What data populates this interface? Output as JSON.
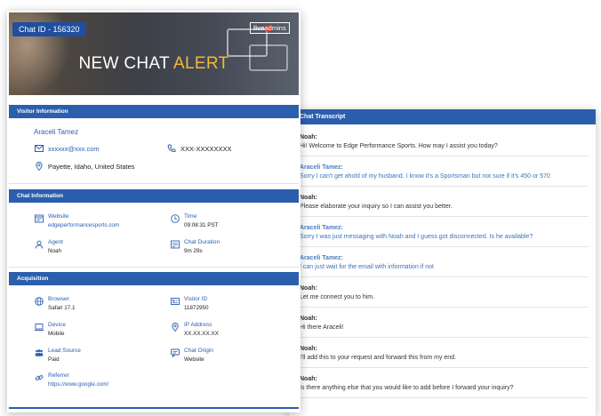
{
  "header": {
    "chat_id": "Chat ID - 156320",
    "logo_live": "live",
    "logo_admins": "admins",
    "title_main": "NEW CHAT ",
    "title_accent": "ALERT"
  },
  "visitor": {
    "section_title": "Visitor Information",
    "name": "Araceli Tamez",
    "email": "xxxxxx@xxx.com",
    "phone": "XXX-XXXXXXXX",
    "location": "Payette, Idaho, United States"
  },
  "chat_info": {
    "section_title": "Chat Information",
    "website_label": "Website",
    "website_value": "edgeperformancesports.com",
    "time_label": "Time",
    "time_value": "09:08:31 PST",
    "agent_label": "Agent",
    "agent_value": "Noah",
    "duration_label": "Chat Duration",
    "duration_value": "9m 29s"
  },
  "acquisition": {
    "section_title": "Acquisition",
    "browser_label": "Browser",
    "browser_value": "Safari 17.1",
    "visitor_id_label": "Visitor ID",
    "visitor_id_value": "11872950",
    "device_label": "Device",
    "device_value": "Mobile",
    "ip_label": "IP Address",
    "ip_value": "XX.XX.XX.XX",
    "lead_label": "Lead Source",
    "lead_value": "Paid",
    "origin_label": "Chat Origin",
    "origin_value": "Website",
    "referrer_label": "Referrer",
    "referrer_value": "https://www.google.com/"
  },
  "transcript": {
    "section_title": "Chat Transcript",
    "messages": [
      {
        "sender": "Noah:",
        "text": "Hi! Welcome to Edge Performance Sports. How may I assist you today?",
        "role": "agent"
      },
      {
        "sender": "Araceli Tamez:",
        "text": "Sorry I can't get ahold of my husband. I know it's a Sportsman but not sure if it's 450 or 570",
        "role": "visitor"
      },
      {
        "sender": "Noah:",
        "text": "Please elaborate your inquiry so I can assist you better.",
        "role": "agent"
      },
      {
        "sender": "Araceli Tamez:",
        "text": "Sorry I was just messaging with Noah and I guess got disconnected. Is he available?",
        "role": "visitor"
      },
      {
        "sender": "Araceli Tamez:",
        "text": "I can just wait for the email with information if not",
        "role": "visitor"
      },
      {
        "sender": "Noah:",
        "text": "Let me connect you to him.",
        "role": "agent"
      },
      {
        "sender": "Noah:",
        "text": "Hi there Araceli!",
        "role": "agent"
      },
      {
        "sender": "Noah:",
        "text": "I'll add this to your request and forward this from my end.",
        "role": "agent"
      },
      {
        "sender": "Noah:",
        "text": "Is there anything else that you would like to add before I forward your inquiry?",
        "role": "agent"
      }
    ]
  },
  "icons": {
    "email": "envelope-icon",
    "phone": "phone-icon",
    "location": "location-pin-icon",
    "website": "website-icon",
    "time": "clock-icon",
    "agent": "agent-icon",
    "duration": "duration-icon",
    "browser": "globe-icon",
    "visitor_id": "id-card-icon",
    "device": "device-icon",
    "ip": "ip-pin-icon",
    "lead": "group-icon",
    "origin": "chat-bubble-icon",
    "referrer": "link-icon"
  },
  "colors": {
    "primary": "#2b5fad",
    "accent": "#f4b934"
  }
}
